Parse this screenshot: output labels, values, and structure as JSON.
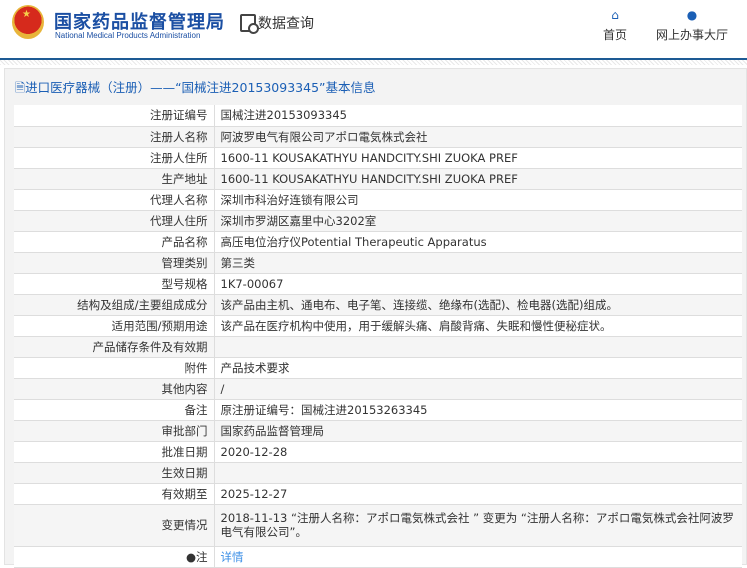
{
  "header": {
    "brand_cn": "国家药品监督管理局",
    "brand_en": "National Medical Products Administration",
    "data_query": "数据查询",
    "nav": [
      {
        "label": "首页",
        "icon": "home-icon"
      },
      {
        "label": "网上办事大厅",
        "icon": "user-icon"
      }
    ]
  },
  "panel": {
    "title": "进口医疗器械（注册）——“国械注进20153093345”基本信息"
  },
  "rows": [
    {
      "label": "注册证编号",
      "value": "国械注进20153093345"
    },
    {
      "label": "注册人名称",
      "value": "阿波罗电气有限公司アポロ電気株式会社"
    },
    {
      "label": "注册人住所",
      "value": "1600-11 KOUSAKATHYU HANDCITY.SHI ZUOKA PREF"
    },
    {
      "label": "生产地址",
      "value": "1600-11 KOUSAKATHYU HANDCITY.SHI ZUOKA PREF"
    },
    {
      "label": "代理人名称",
      "value": "深圳市科治好连锁有限公司"
    },
    {
      "label": "代理人住所",
      "value": "深圳市罗湖区嘉里中心3202室"
    },
    {
      "label": "产品名称",
      "value": "高压电位治疗仪Potential Therapeutic Apparatus"
    },
    {
      "label": "管理类别",
      "value": "第三类"
    },
    {
      "label": "型号规格",
      "value": "1K7-00067"
    },
    {
      "label": "结构及组成/主要组成成分",
      "value": "该产品由主机、通电布、电子笔、连接缆、绝缘布(选配)、检电器(选配)组成。"
    },
    {
      "label": "适用范围/预期用途",
      "value": "该产品在医疗机构中使用，用于缓解头痛、肩酸背痛、失眠和慢性便秘症状。"
    },
    {
      "label": "产品储存条件及有效期",
      "value": ""
    },
    {
      "label": "附件",
      "value": "产品技术要求"
    },
    {
      "label": "其他内容",
      "value": "/"
    },
    {
      "label": "备注",
      "value": "原注册证编号：国械注进20153263345"
    },
    {
      "label": "审批部门",
      "value": "国家药品监督管理局"
    },
    {
      "label": "批准日期",
      "value": "2020-12-28"
    },
    {
      "label": "生效日期",
      "value": ""
    },
    {
      "label": "有效期至",
      "value": "2025-12-27"
    },
    {
      "label": "变更情况",
      "value": "2018-11-13 “注册人名称：アポロ電気株式会社 ” 变更为 “注册人名称：アポロ電気株式会社阿波罗电气有限公司”。"
    }
  ],
  "note": {
    "label": "注",
    "link": "详情"
  }
}
